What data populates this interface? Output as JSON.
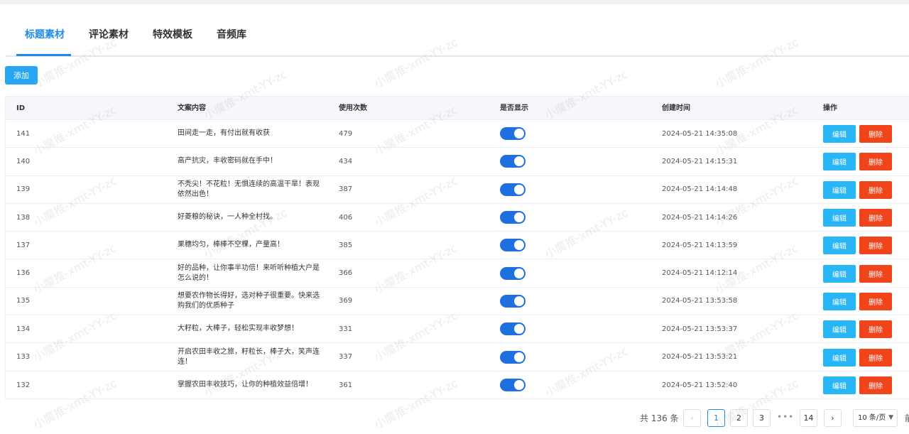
{
  "tabs": [
    {
      "label": "标题素材",
      "active": true
    },
    {
      "label": "评论素材",
      "active": false
    },
    {
      "label": "特效模板",
      "active": false
    },
    {
      "label": "音频库",
      "active": false
    }
  ],
  "add_label": "添加",
  "columns": [
    "ID",
    "文案内容",
    "使用次数",
    "是否显示",
    "创建时间",
    "操作"
  ],
  "rows": [
    {
      "id": "141",
      "content": "田间走一走，有付出就有收获",
      "uses": "479",
      "shown": true,
      "created": "2024-05-21 14:35:08"
    },
    {
      "id": "140",
      "content": "高产抗灾，丰收密码就在手中！",
      "uses": "434",
      "shown": true,
      "created": "2024-05-21 14:15:31"
    },
    {
      "id": "139",
      "content": "不秃尖！不花粒！无惧连续的高温干旱！表现依然出色！",
      "uses": "387",
      "shown": true,
      "created": "2024-05-21 14:14:48"
    },
    {
      "id": "138",
      "content": "好菱粮的秘诀，一人种全村找。",
      "uses": "406",
      "shown": true,
      "created": "2024-05-21 14:14:26"
    },
    {
      "id": "137",
      "content": "果穗均匀，棒棒不空棵，产量高！",
      "uses": "385",
      "shown": true,
      "created": "2024-05-21 14:13:59"
    },
    {
      "id": "136",
      "content": "好的品种，让你事半功倍！来听听种植大户是怎么说的！",
      "uses": "366",
      "shown": true,
      "created": "2024-05-21 14:12:14"
    },
    {
      "id": "135",
      "content": "想要农作物长得好，选对种子很重要。快来选购我们的优质种子",
      "uses": "369",
      "shown": true,
      "created": "2024-05-21 13:53:58"
    },
    {
      "id": "134",
      "content": "大籽粒，大棒子，轻松实现丰收梦想！",
      "uses": "331",
      "shown": true,
      "created": "2024-05-21 13:53:37"
    },
    {
      "id": "133",
      "content": "开启农田丰收之旅，籽粒长，棒子大，笑声连连！",
      "uses": "337",
      "shown": true,
      "created": "2024-05-21 13:53:21"
    },
    {
      "id": "132",
      "content": "掌握农田丰收技巧，让你的种植效益倍增！",
      "uses": "361",
      "shown": true,
      "created": "2024-05-21 13:52:40"
    }
  ],
  "actions": {
    "edit": "编辑",
    "delete": "删除"
  },
  "pagination": {
    "total_text": "共 136 条",
    "prev": "‹",
    "next": "›",
    "pages": [
      "1",
      "2",
      "3"
    ],
    "ellipsis": "•••",
    "last": "14",
    "current": "1",
    "page_size": "10 条/页",
    "goto_prefix": "前"
  },
  "watermark": "小魔推-xmt-YY-zc",
  "colors": {
    "primary": "#1e8be8",
    "edit": "#29b6f6",
    "delete": "#f0441a",
    "switch_on": "#1e6fe0"
  },
  "icons": {
    "page_size_chevron": "chevron-down-icon",
    "prev": "chevron-left-icon",
    "next": "chevron-right-icon"
  }
}
